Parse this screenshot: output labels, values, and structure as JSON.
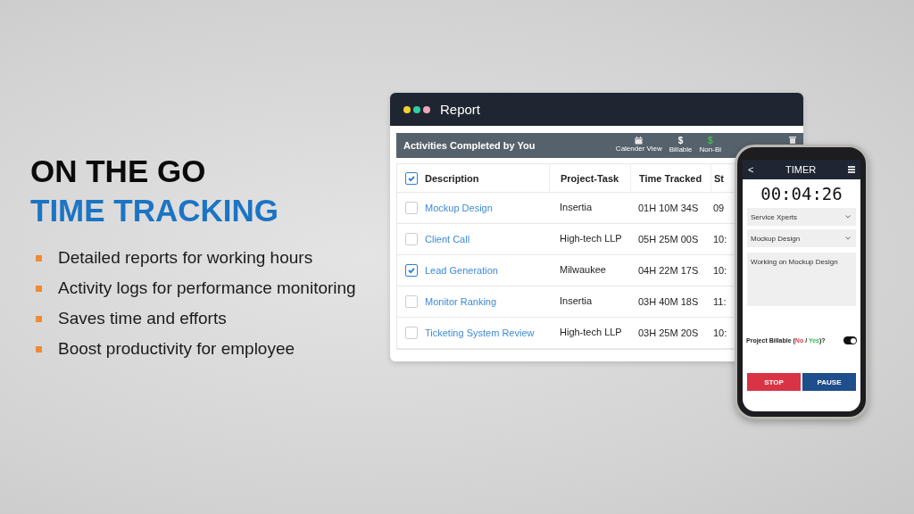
{
  "headline": {
    "line_1": "ON THE GO",
    "line_2": "TIME TRACKING"
  },
  "features": [
    "Detailed reports for working hours",
    "Activity logs for performance monitoring",
    "Saves time and efforts",
    "Boost productivity for employee"
  ],
  "report": {
    "title": "Report",
    "toolbar": {
      "title": "Activities Completed by You",
      "actions": [
        {
          "kind": "calendar",
          "label": "Calender View"
        },
        {
          "kind": "symbol",
          "symbol": "$",
          "label": "Billable",
          "color": "#ffffff"
        },
        {
          "kind": "symbol",
          "symbol": "$",
          "label": "Non-Bi",
          "color": "#3fbf4f"
        }
      ]
    },
    "table": {
      "select_all_checked": true,
      "columns": [
        "Description",
        "Project-Task",
        "Time Tracked",
        "St"
      ],
      "rows": [
        {
          "checked": false,
          "description": "Mockup Design",
          "project": "Insertia",
          "time": "01H 10M 34S",
          "column_4": "09"
        },
        {
          "checked": false,
          "description": "Client Call",
          "project": "High-tech LLP",
          "time": "05H 25M 00S",
          "column_4": "10:"
        },
        {
          "checked": true,
          "description": "Lead Generation",
          "project": "Milwaukee",
          "time": "04H 22M 17S",
          "column_4": "10:"
        },
        {
          "checked": false,
          "description": "Monitor Ranking",
          "project": "Insertia",
          "time": "03H 40M 18S",
          "column_4": "11:"
        },
        {
          "checked": false,
          "description": "Ticketing System Review",
          "project": "High-tech LLP",
          "time": "03H 25M 20S",
          "column_4": "10:"
        }
      ]
    }
  },
  "phone": {
    "back": "<",
    "title": "TIMER",
    "timer": "00:04:26",
    "dropdowns": [
      "Service Xperts",
      "Mockup Design"
    ],
    "note": "Working on Mockup Design",
    "billable": {
      "prefix": "Project Billable (",
      "no": "No",
      "separator": " / ",
      "yes": "Yes",
      "suffix": ")?",
      "on": true
    },
    "buttons": [
      "STOP",
      "PAUSE"
    ]
  }
}
